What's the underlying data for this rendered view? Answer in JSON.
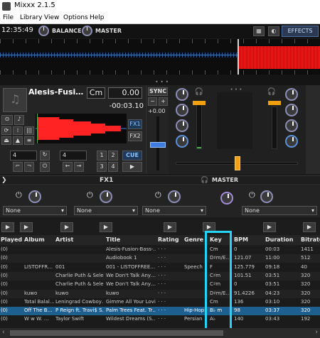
{
  "app": {
    "title": "Mixxx 2.1.5"
  },
  "menu": [
    "File",
    "Library",
    "View",
    "Options",
    "Help"
  ],
  "topbar": {
    "clock": "12:35:49",
    "balance_label": "BALANCE",
    "master_label": "MASTER",
    "effects_label": "EFFECTS"
  },
  "deck": {
    "track_title": "Alesis-Fusi…",
    "key": "Cm",
    "position": "0.00",
    "time_remaining": "-00:03.10",
    "fx1": "FX1",
    "fx2": "FX2",
    "cue": "CUE",
    "loop_size": "4",
    "beatjump_size": "4",
    "hotcues": [
      "1",
      "2",
      "3",
      "4"
    ]
  },
  "sync": {
    "label": "SYNC",
    "rate": "+0.00",
    "minus": "−",
    "plus": "+"
  },
  "fxbar": {
    "fx1_label": "FX1",
    "master_label": "MASTER"
  },
  "effect_units": [
    {
      "select": "None"
    },
    {
      "select": "None"
    },
    {
      "select": "None"
    },
    {
      "select": "None"
    }
  ],
  "library": {
    "headers": [
      "Played",
      "Album",
      "Artist",
      "Title",
      "Rating",
      "Genre",
      "Key",
      "BPM",
      "Duration",
      "Bitrate"
    ],
    "rows": [
      {
        "played": "(0)",
        "album": "",
        "artist": "",
        "title": "Alesis-Fusion-Bass-…",
        "rating": "",
        "genre": "",
        "key": "Cm",
        "bpm": "0",
        "duration": "00:03",
        "bitrate": "1411"
      },
      {
        "played": "(0)",
        "album": "",
        "artist": "",
        "title": "Audiobook 1",
        "rating": "",
        "genre": "",
        "key": "D♯m/E…",
        "bpm": "121.07",
        "duration": "11:00",
        "bitrate": "512"
      },
      {
        "played": "(0)",
        "album": "LISTOFFR…",
        "artist": "001",
        "title": "001 - LISTOFFREE…",
        "rating": "",
        "genre": "Speech",
        "key": "F",
        "bpm": "125.779",
        "duration": "09:18",
        "bitrate": "40"
      },
      {
        "played": "(0)",
        "album": "",
        "artist": "Charlie Puth & Sele…",
        "title": "We Don't Talk Any…",
        "rating": "",
        "genre": "",
        "key": "C♯m",
        "bpm": "101.51",
        "duration": "03:51",
        "bitrate": "320"
      },
      {
        "played": "(0)",
        "album": "",
        "artist": "Charlie Puth & Sele…",
        "title": "We Don't Talk Any…",
        "rating": "",
        "genre": "",
        "key": "C♯m",
        "bpm": "0",
        "duration": "03:51",
        "bitrate": "320"
      },
      {
        "played": "(0)",
        "album": "kuwo",
        "artist": "kuwo",
        "title": "kuwo",
        "rating": "",
        "genre": "",
        "key": "D♯m/E…",
        "bpm": "91.4226",
        "duration": "04:23",
        "bitrate": "320"
      },
      {
        "played": "(0)",
        "album": "Total Balal…",
        "artist": "Leningrad Cowboy…",
        "title": "Gimme All Your Lovin'",
        "rating": "",
        "genre": "",
        "key": "Cm",
        "bpm": "136",
        "duration": "03:10",
        "bitrate": "320"
      },
      {
        "played": "(0)",
        "album": "Off The B…",
        "artist": "P Reign ft. Travi$ S…",
        "title": "Palm Trees Feat. Tr…",
        "rating": "",
        "genre": "Hip-Hop",
        "key": "B♭ m",
        "bpm": "98",
        "duration": "03:37",
        "bitrate": "320"
      },
      {
        "played": "(0)",
        "album": "W w W. …",
        "artist": "Taylor Swift",
        "title": "Wildest Dreams (S…",
        "rating": "",
        "genre": "Persian",
        "key": "A♭",
        "bpm": "140",
        "duration": "03:43",
        "bitrate": "192"
      }
    ]
  },
  "colors": {
    "accent": "#1d5f8f",
    "highlight": "#25d5f5",
    "waveform": "#ff2020",
    "knob_ring": "#8d8db5",
    "fader": "#f0a010"
  }
}
